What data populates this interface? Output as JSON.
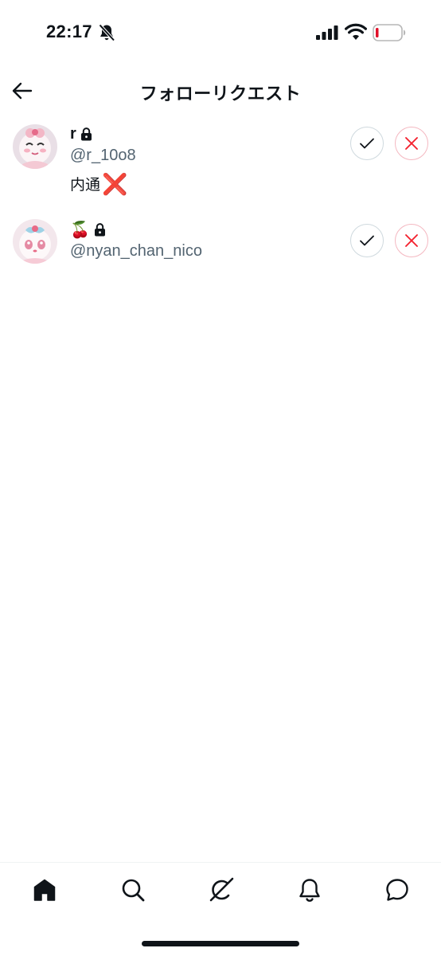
{
  "status_bar": {
    "time": "22:17",
    "icons": [
      "bell-slash-icon",
      "signal-icon",
      "wifi-icon",
      "battery-icon"
    ]
  },
  "header": {
    "back_icon": "arrow-left-icon",
    "title": "フォローリクエスト"
  },
  "requests": [
    {
      "display_name": "r",
      "handle": "@r_10o8",
      "bio_text": "内通",
      "bio_emoji": "❌",
      "protected": true
    },
    {
      "display_name": "🍒",
      "handle": "@nyan_chan_nico",
      "bio_text": "",
      "bio_emoji": "",
      "protected": true
    }
  ],
  "actions": {
    "accept_icon": "check-icon",
    "decline_icon": "x-icon"
  },
  "bottom_nav": {
    "items": [
      "home-icon",
      "search-icon",
      "grok-icon",
      "bell-icon",
      "message-icon"
    ],
    "active": "home-icon"
  },
  "colors": {
    "text_primary": "#0f1419",
    "text_secondary": "#536471",
    "accept_border": "#cfd9de",
    "decline": "#f4212e",
    "decline_border": "#f4b8c1",
    "battery_low": "#e0112a"
  }
}
